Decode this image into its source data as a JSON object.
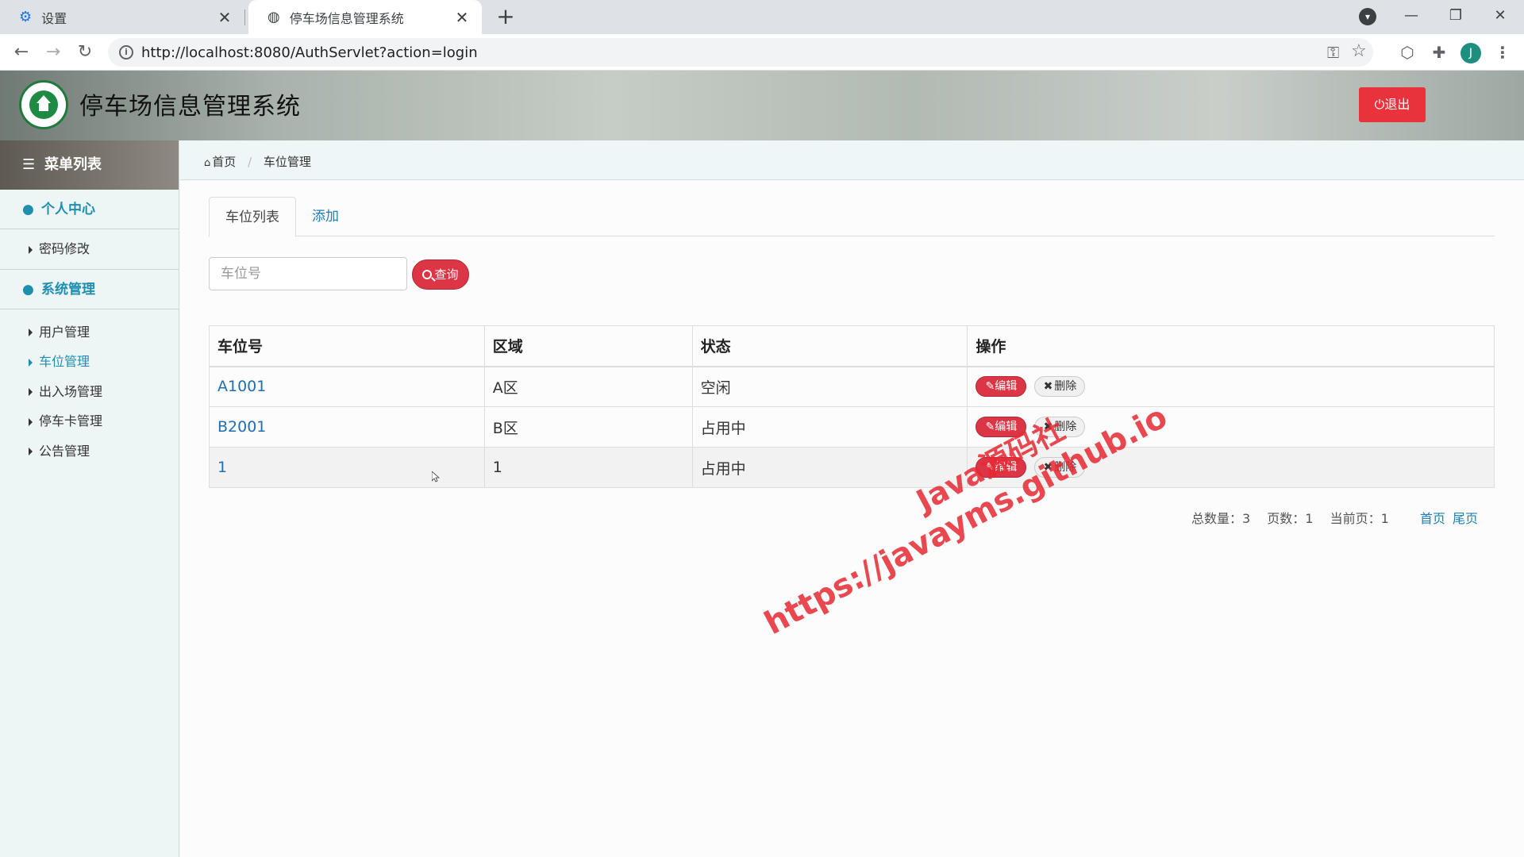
{
  "browser": {
    "tabs": [
      {
        "title": "设置",
        "icon": "gear-icon"
      },
      {
        "title": "停车场信息管理系统",
        "icon": "globe-icon"
      }
    ],
    "url": "http://localhost:8080/AuthServlet?action=login",
    "avatar_letter": "J"
  },
  "header": {
    "title": "停车场信息管理系统",
    "logout_label": "退出"
  },
  "sidebar": {
    "menu_title": "菜单列表",
    "groups": [
      {
        "title": "个人中心",
        "items": [
          "密码修改"
        ]
      },
      {
        "title": "系统管理",
        "items": [
          "用户管理",
          "车位管理",
          "出入场管理",
          "停车卡管理",
          "公告管理"
        ]
      }
    ],
    "active_item": "车位管理"
  },
  "breadcrumb": {
    "home": "首页",
    "current": "车位管理"
  },
  "tabs": [
    {
      "label": "车位列表",
      "active": true
    },
    {
      "label": "添加",
      "active": false
    }
  ],
  "search": {
    "placeholder": "车位号",
    "button_label": "查询"
  },
  "table": {
    "headers": [
      "车位号",
      "区域",
      "状态",
      "操作"
    ],
    "rows": [
      {
        "code": "A1001",
        "area": "A区",
        "status": "空闲"
      },
      {
        "code": "B2001",
        "area": "B区",
        "status": "占用中"
      },
      {
        "code": "1",
        "area": "1",
        "status": "占用中"
      }
    ],
    "edit_label": "编辑",
    "delete_label": "删除"
  },
  "pager": {
    "total_label": "总数量：3",
    "pages_label": "页数：1",
    "current_label": "当前页：1",
    "first_label": "首页",
    "last_label": "尾页"
  },
  "watermark": {
    "line1": "Java源码社",
    "line2": "https://javayms.github.io"
  },
  "colors": {
    "accent": "#1f8fb0",
    "danger": "#dc3545",
    "link": "#1f6fb0"
  }
}
